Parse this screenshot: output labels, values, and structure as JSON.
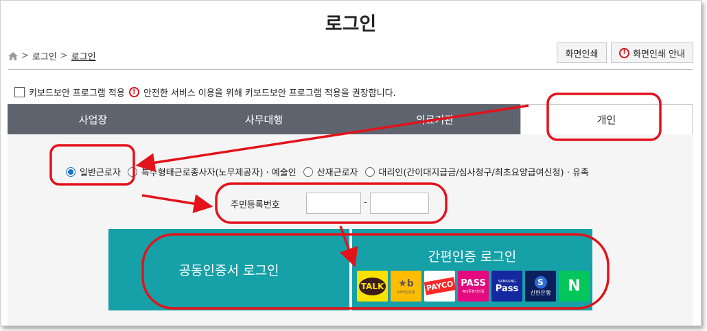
{
  "page": {
    "title": "로그인"
  },
  "breadcrumb": {
    "items": [
      "로그인",
      "로그인"
    ],
    "separator": ">"
  },
  "toolbar": {
    "print_label": "화면인쇄",
    "print_guide_label": "화면인쇄 안내"
  },
  "keyboard": {
    "checkbox_label": "키보드보안 프로그램 적용",
    "notice": "안전한 서비스 이용을 위해 키보드보안 프로그램 적용을 권장합니다."
  },
  "tabs": [
    {
      "label": "사업장",
      "active": false
    },
    {
      "label": "사무대행",
      "active": false
    },
    {
      "label": "의료기관",
      "active": false
    },
    {
      "label": "개인",
      "active": true
    }
  ],
  "user_types": [
    {
      "label": "일반근로자",
      "selected": true
    },
    {
      "label": "특수형태근로종사자(노무제공자) · 예술인",
      "selected": false
    },
    {
      "label": "산재근로자",
      "selected": false
    },
    {
      "label": "대리인(간이대지급금/심사청구/최초요양급여신청) · 유족",
      "selected": false
    }
  ],
  "resident_id": {
    "label": "주민등록번호",
    "separator": "-",
    "front_value": "",
    "back_value": ""
  },
  "login": {
    "certificate_label": "공동인증서 로그인",
    "simple_label": "간편인증 로그인",
    "providers": [
      {
        "label": "TALK",
        "sub": "",
        "icon": "kakao-icon",
        "bg": "#fae100",
        "fg": "#3a1d1d"
      },
      {
        "label": "★b",
        "sub": "KB국민은행",
        "icon": "kb-icon",
        "bg": "#ffbc00",
        "fg": "#60584c"
      },
      {
        "label": "PAYCO",
        "sub": "",
        "icon": "payco-icon",
        "bg": "#ffffff",
        "fg": "#fa2828"
      },
      {
        "label": "PASS",
        "sub": "휴대폰본인인증",
        "icon": "pass-icon",
        "bg": "#e5097f",
        "fg": "#ffffff"
      },
      {
        "label": "Pass",
        "sub": "SAMSUNG",
        "icon": "samsung-pass-icon",
        "bg": "#1428a0",
        "fg": "#ffffff"
      },
      {
        "label": "S",
        "sub": "신한은행",
        "icon": "shinhan-icon",
        "bg": "#0b1f5c",
        "fg": "#ffffff"
      },
      {
        "label": "N",
        "sub": "",
        "icon": "naver-icon",
        "bg": "#03c75a",
        "fg": "#ffffff"
      }
    ]
  },
  "colors": {
    "accent": "#16a0a8",
    "tab_bg": "#5e636e",
    "annotation": "#e3121b",
    "radio": "#1a73c8"
  }
}
